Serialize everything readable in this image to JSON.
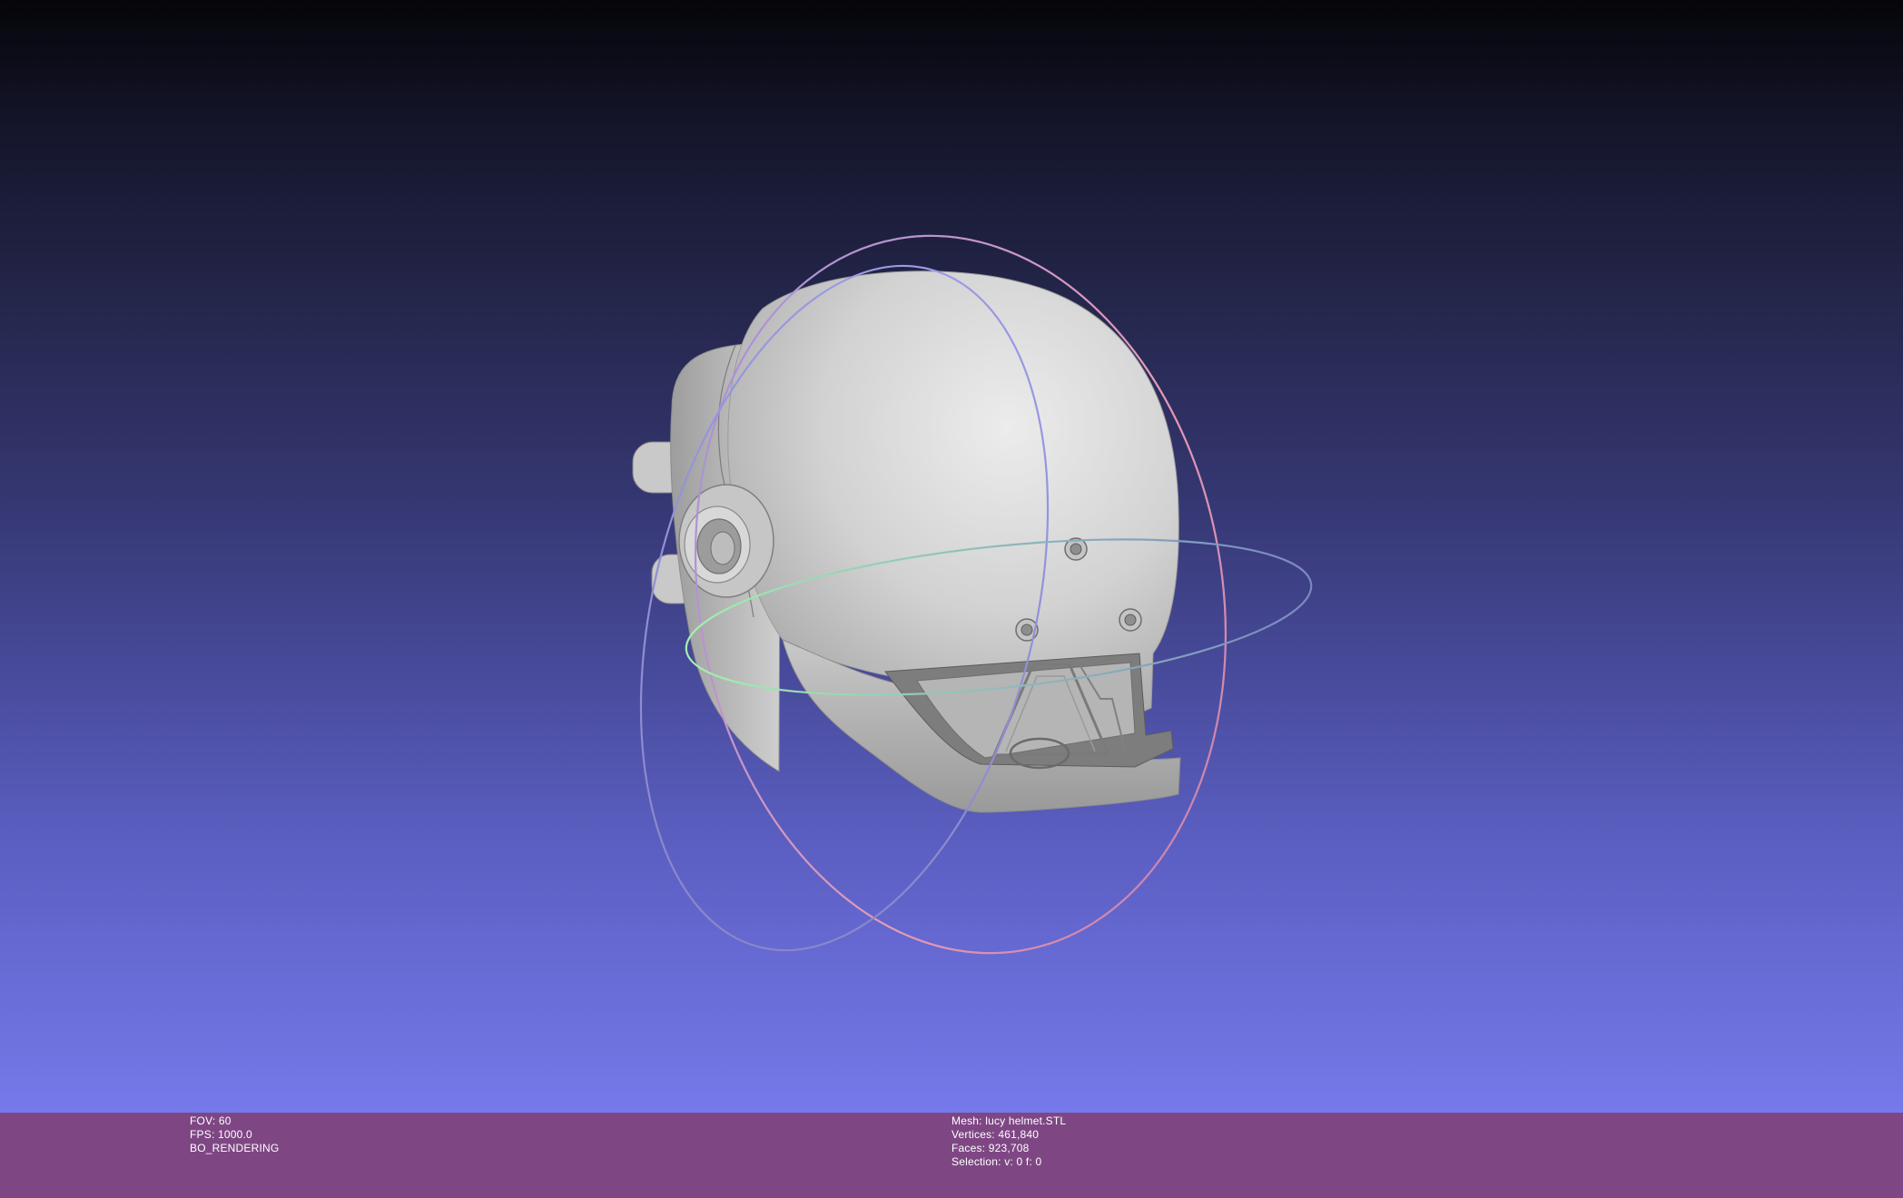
{
  "viewer": {
    "colors": {
      "background_top": "#05050a",
      "background_bottom": "#7579ea",
      "status_bar": "#7e4784",
      "mesh": "#d4d4d4",
      "trackball_x": "#ee9cae",
      "trackball_y": "#99ee99",
      "trackball_z": "#a8a8f2"
    },
    "model": "helmet-mesh",
    "trackball": [
      "x-ring",
      "y-ring",
      "z-ring"
    ]
  },
  "status_left": {
    "fov": "FOV: 60",
    "fps": "FPS:  1000.0",
    "mode": "BO_RENDERING"
  },
  "status_right": {
    "mesh": "Mesh: lucy helmet.STL",
    "vertices": "Vertices: 461,840",
    "faces": "Faces: 923,708",
    "selection": "Selection: v: 0 f: 0"
  }
}
